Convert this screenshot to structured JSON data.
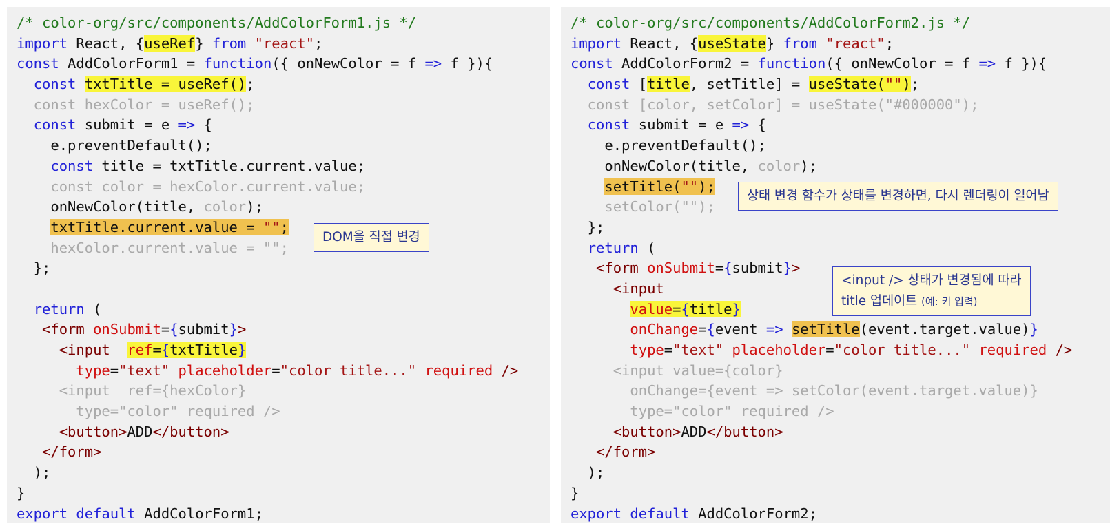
{
  "left": {
    "comment": "/* color-org/src/components/AddColorForm1.js */",
    "annotation": "DOM을 직접 변경"
  },
  "right": {
    "comment": "/* color-org/src/components/AddColorForm2.js */",
    "annotation_1": "상태 변경 함수가 상태를 변경하면, 다시 렌더링이 일어남",
    "annotation_2_line1": "<input /> 상태가 변경됨에 따라",
    "annotation_2_line2a": "title 업데이트",
    "annotation_2_line2b": "(예: 키 입력)"
  },
  "colors": {
    "panel_bg": "#f0f0f0",
    "comment": "#237a1e",
    "keyword": "#2222d8",
    "string": "#a31515",
    "tag": "#7a0000",
    "attribute": "#d01010",
    "dimmed": "#a9a9a9",
    "highlight_yellow": "#f9f53a",
    "highlight_orange": "#f0c14f",
    "note_border": "#3a44c8"
  }
}
